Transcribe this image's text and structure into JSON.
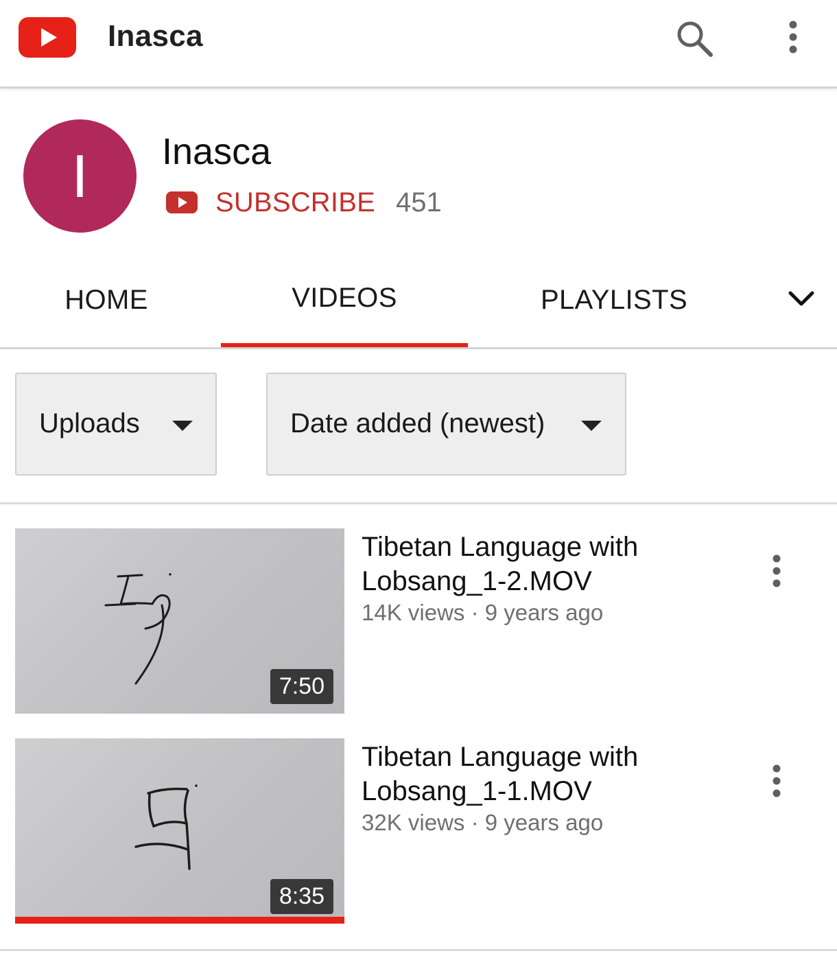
{
  "appbar": {
    "title": "Inasca",
    "logo_icon": "youtube-logo-icon",
    "search_icon": "search-icon",
    "more_icon": "more-vert-icon"
  },
  "channel": {
    "avatar_letter": "I",
    "avatar_color": "#b0295a",
    "name": "Inasca",
    "subscribe_label": "SUBSCRIBE",
    "subscriber_count": "451",
    "accent_color": "#c4302b"
  },
  "tabs": [
    {
      "label": "HOME",
      "selected": false
    },
    {
      "label": "VIDEOS",
      "selected": true
    },
    {
      "label": "PLAYLISTS",
      "selected": false
    }
  ],
  "tabs_more_icon": "chevron-down-icon",
  "filters": {
    "uploads_label": "Uploads",
    "sort_label": "Date added (newest)"
  },
  "videos": [
    {
      "title": "Tibetan Language with Lobsang_1-2.MOV",
      "views": "14K views",
      "age": "9 years ago",
      "duration": "7:50",
      "watched_fraction": 0
    },
    {
      "title": "Tibetan Language with Lobsang_1-1.MOV",
      "views": "32K views",
      "age": "9 years ago",
      "duration": "8:35",
      "watched_fraction": 1
    }
  ],
  "separator": " · "
}
